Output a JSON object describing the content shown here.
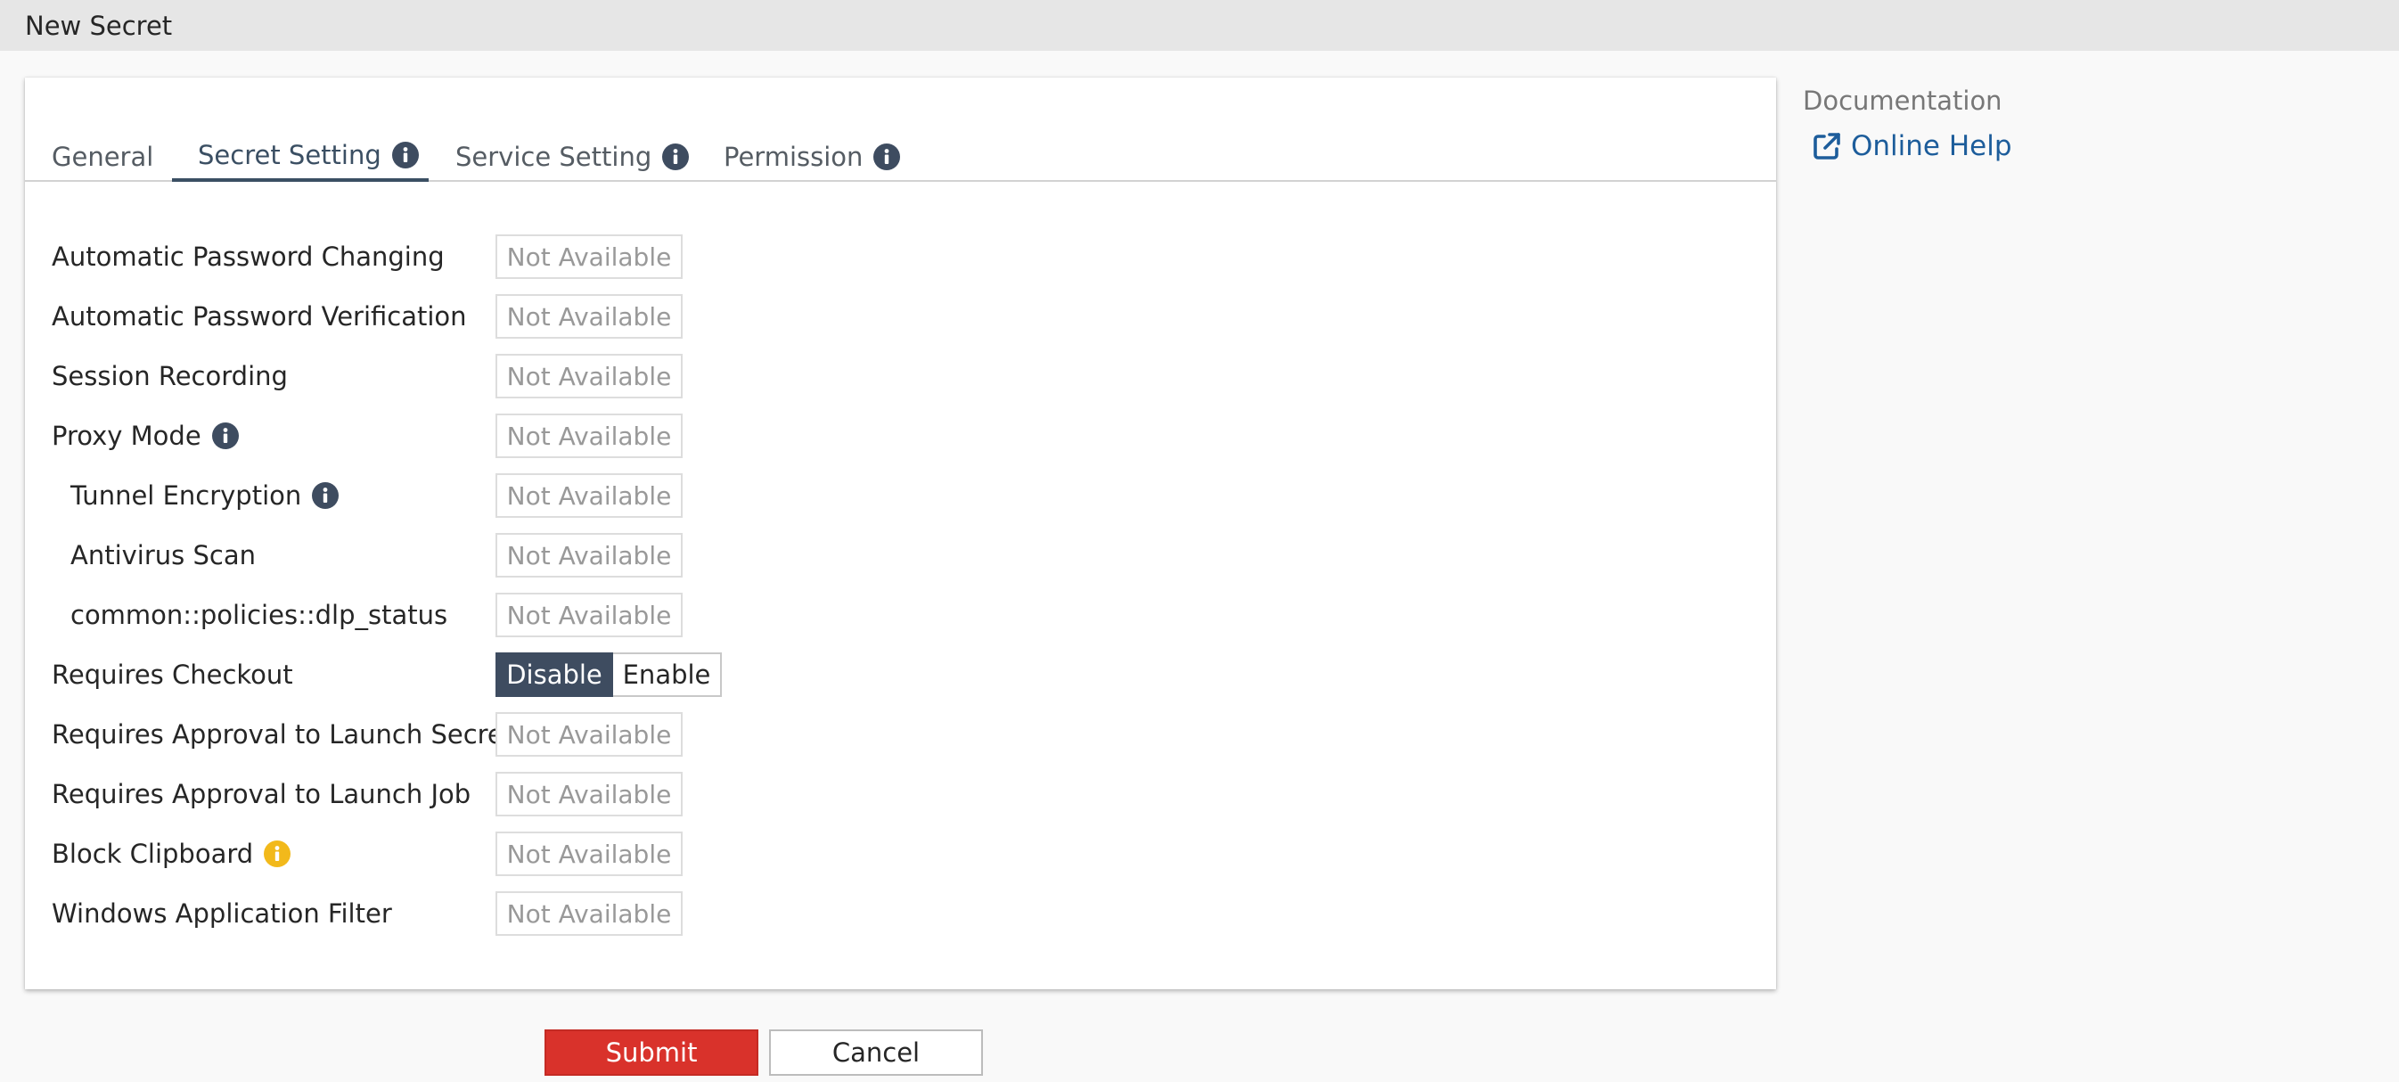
{
  "window": {
    "title": "New Secret"
  },
  "tabs": [
    {
      "label": "General",
      "active": false,
      "info": false
    },
    {
      "label": "Secret Setting",
      "active": true,
      "info": true
    },
    {
      "label": "Service Setting",
      "active": false,
      "info": true
    },
    {
      "label": "Permission",
      "active": false,
      "info": true
    }
  ],
  "settings": [
    {
      "label": "Automatic Password Changing",
      "value": "Not Available"
    },
    {
      "label": "Automatic Password Verification",
      "value": "Not Available"
    },
    {
      "label": "Session Recording",
      "value": "Not Available"
    },
    {
      "label": "Proxy Mode",
      "value": "Not Available",
      "info_icon": "info-icon"
    },
    {
      "label": "Tunnel Encryption",
      "value": "Not Available",
      "info_icon": "info-icon",
      "indented": true
    },
    {
      "label": "Antivirus Scan",
      "value": "Not Available",
      "indented": true
    },
    {
      "label": "common::policies::dlp_status",
      "value": "Not Available",
      "indented": true
    },
    {
      "label": "Requires Checkout",
      "toggle": {
        "on": "Disable",
        "off": "Enable",
        "selected": "Disable"
      }
    },
    {
      "label": "Requires Approval to Launch Secret",
      "value": "Not Available"
    },
    {
      "label": "Requires Approval to Launch Job",
      "value": "Not Available"
    },
    {
      "label": "Block Clipboard",
      "value": "Not Available",
      "info_icon": "warning-info-icon"
    },
    {
      "label": "Windows Application Filter",
      "value": "Not Available"
    }
  ],
  "actions": {
    "submit": "Submit",
    "cancel": "Cancel"
  },
  "documentation": {
    "title": "Documentation",
    "link": "Online Help",
    "link_icon": "external-link-icon"
  },
  "colors": {
    "accent": "#3e4c60",
    "submit": "#d9322b",
    "link": "#1d5d9b",
    "warning_icon": "#f2b91b"
  }
}
